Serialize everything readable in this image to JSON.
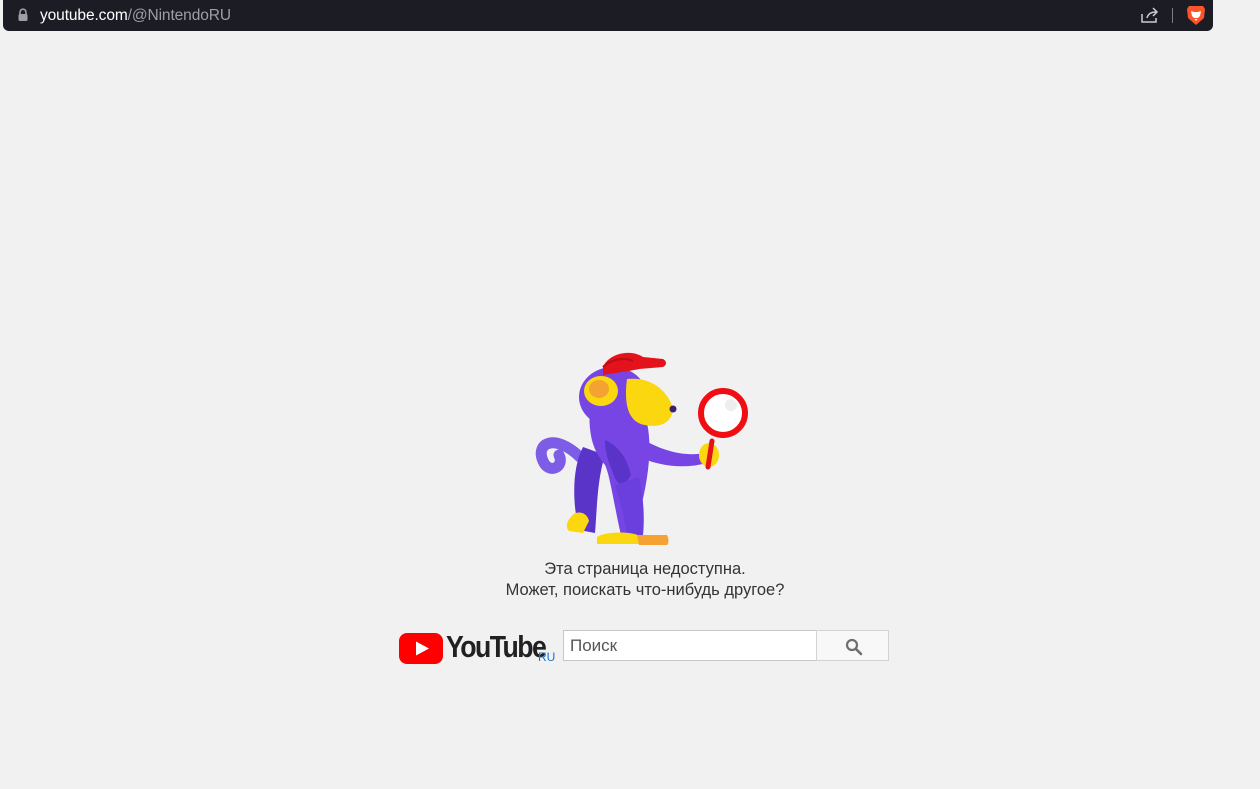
{
  "browser": {
    "url_domain": "youtube.com",
    "url_path": "/@NintendoRU",
    "icons": {
      "lock": "lock-icon",
      "share": "share-icon",
      "brave": "brave-lion-icon"
    },
    "colors": {
      "bar_background": "#1c1d24",
      "brave_orange": "#fb542b"
    }
  },
  "error": {
    "illustration": "monkey-magnifier-icon",
    "line1": "Эта страница недоступна.",
    "line2": "Может, поискать что-нибудь другое?"
  },
  "footer_search": {
    "logo_text": "YouTube",
    "region": "RU",
    "placeholder": "Поиск",
    "search_icon": "search-icon",
    "colors": {
      "logo_red": "#ff0000",
      "region_blue": "#1a73c8"
    }
  }
}
